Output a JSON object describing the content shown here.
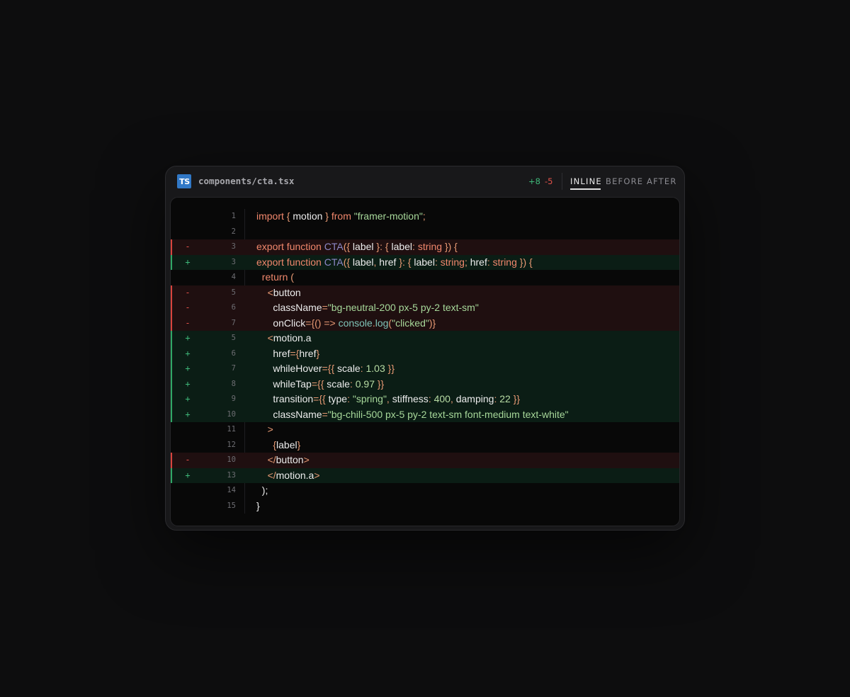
{
  "file": {
    "icon": "typescript-icon",
    "badge": "TS",
    "name": "components/cta.tsx"
  },
  "stats": {
    "added": "+8",
    "removed": "-5"
  },
  "tabs": [
    {
      "label": "INLINE",
      "active": true
    },
    {
      "label": "BEFORE",
      "active": false
    },
    {
      "label": "AFTER",
      "active": false
    }
  ],
  "colors": {
    "added": "#3fb97a",
    "removed": "#e5534b",
    "added_bg": "#0b1d15",
    "removed_bg": "#1f0f10",
    "ts_blue": "#3178c6"
  },
  "lines": [
    {
      "type": "ctx",
      "num": "1",
      "tokens": [
        [
          "kw",
          "import"
        ],
        [
          "id",
          " "
        ],
        [
          "pn",
          "{"
        ],
        [
          "id",
          " motion "
        ],
        [
          "pn",
          "}"
        ],
        [
          "id",
          " "
        ],
        [
          "kw",
          "from"
        ],
        [
          "id",
          " "
        ],
        [
          "str",
          "\"framer-motion\""
        ],
        [
          "pn",
          ";"
        ]
      ]
    },
    {
      "type": "ctx",
      "num": "2",
      "tokens": []
    },
    {
      "type": "del",
      "num": "3",
      "tokens": [
        [
          "kw",
          "export function"
        ],
        [
          "id",
          " "
        ],
        [
          "fn",
          "CTA"
        ],
        [
          "pn",
          "({"
        ],
        [
          "id",
          " label "
        ],
        [
          "pn",
          "}:"
        ],
        [
          "id",
          " "
        ],
        [
          "pn",
          "{"
        ],
        [
          "id",
          " label"
        ],
        [
          "pn",
          ":"
        ],
        [
          "id",
          " "
        ],
        [
          "kw",
          "string"
        ],
        [
          "id",
          " "
        ],
        [
          "pn",
          "})"
        ],
        [
          "id",
          " "
        ],
        [
          "pn",
          "{"
        ]
      ]
    },
    {
      "type": "add",
      "num": "3",
      "tokens": [
        [
          "kw",
          "export function"
        ],
        [
          "id",
          " "
        ],
        [
          "fn",
          "CTA"
        ],
        [
          "pn",
          "({"
        ],
        [
          "id",
          " label"
        ],
        [
          "pn",
          ","
        ],
        [
          "id",
          " href "
        ],
        [
          "pn",
          "}:"
        ],
        [
          "id",
          " "
        ],
        [
          "pn",
          "{"
        ],
        [
          "id",
          " label"
        ],
        [
          "pn",
          ":"
        ],
        [
          "id",
          " "
        ],
        [
          "kw",
          "string"
        ],
        [
          "pn",
          ";"
        ],
        [
          "id",
          " href"
        ],
        [
          "pn",
          ":"
        ],
        [
          "id",
          " "
        ],
        [
          "kw",
          "string"
        ],
        [
          "id",
          " "
        ],
        [
          "pn",
          "})"
        ],
        [
          "id",
          " "
        ],
        [
          "pn",
          "{"
        ]
      ]
    },
    {
      "type": "ctx",
      "num": "4",
      "tokens": [
        [
          "id",
          "  "
        ],
        [
          "kw",
          "return"
        ],
        [
          "id",
          " "
        ],
        [
          "pn",
          "("
        ]
      ]
    },
    {
      "type": "del",
      "num": "5",
      "tokens": [
        [
          "id",
          "    "
        ],
        [
          "pn",
          "<"
        ],
        [
          "id",
          "button"
        ]
      ]
    },
    {
      "type": "del",
      "num": "6",
      "tokens": [
        [
          "id",
          "      className"
        ],
        [
          "op",
          "="
        ],
        [
          "str",
          "\"bg-neutral-200 px-5 py-2 text-sm\""
        ]
      ]
    },
    {
      "type": "del",
      "num": "7",
      "tokens": [
        [
          "id",
          "      onClick"
        ],
        [
          "op",
          "="
        ],
        [
          "pn",
          "{()"
        ],
        [
          "id",
          " "
        ],
        [
          "op",
          "=>"
        ],
        [
          "id",
          " "
        ],
        [
          "fn2",
          "console"
        ],
        [
          "pn",
          "."
        ],
        [
          "fn2",
          "log"
        ],
        [
          "pn",
          "("
        ],
        [
          "str",
          "\"clicked\""
        ],
        [
          "pn",
          ")}"
        ]
      ]
    },
    {
      "type": "add",
      "num": "5",
      "tokens": [
        [
          "id",
          "    "
        ],
        [
          "pn",
          "<"
        ],
        [
          "id",
          "motion.a"
        ]
      ]
    },
    {
      "type": "add",
      "num": "6",
      "tokens": [
        [
          "id",
          "      href"
        ],
        [
          "op",
          "="
        ],
        [
          "pn",
          "{"
        ],
        [
          "id",
          "href"
        ],
        [
          "pn",
          "}"
        ]
      ]
    },
    {
      "type": "add",
      "num": "7",
      "tokens": [
        [
          "id",
          "      whileHover"
        ],
        [
          "op",
          "="
        ],
        [
          "pn",
          "{{"
        ],
        [
          "id",
          " scale"
        ],
        [
          "pn",
          ":"
        ],
        [
          "id",
          " "
        ],
        [
          "num",
          "1.03"
        ],
        [
          "id",
          " "
        ],
        [
          "pn",
          "}}"
        ]
      ]
    },
    {
      "type": "add",
      "num": "8",
      "tokens": [
        [
          "id",
          "      whileTap"
        ],
        [
          "op",
          "="
        ],
        [
          "pn",
          "{{"
        ],
        [
          "id",
          " scale"
        ],
        [
          "pn",
          ":"
        ],
        [
          "id",
          " "
        ],
        [
          "num",
          "0.97"
        ],
        [
          "id",
          " "
        ],
        [
          "pn",
          "}}"
        ]
      ]
    },
    {
      "type": "add",
      "num": "9",
      "tokens": [
        [
          "id",
          "      transition"
        ],
        [
          "op",
          "="
        ],
        [
          "pn",
          "{{"
        ],
        [
          "id",
          " type"
        ],
        [
          "pn",
          ":"
        ],
        [
          "id",
          " "
        ],
        [
          "str",
          "\"spring\""
        ],
        [
          "pn",
          ","
        ],
        [
          "id",
          " stiffness"
        ],
        [
          "pn",
          ":"
        ],
        [
          "id",
          " "
        ],
        [
          "num",
          "400"
        ],
        [
          "pn",
          ","
        ],
        [
          "id",
          " damping"
        ],
        [
          "pn",
          ":"
        ],
        [
          "id",
          " "
        ],
        [
          "num",
          "22"
        ],
        [
          "id",
          " "
        ],
        [
          "pn",
          "}}"
        ]
      ]
    },
    {
      "type": "add",
      "num": "10",
      "tokens": [
        [
          "id",
          "      className"
        ],
        [
          "op",
          "="
        ],
        [
          "str",
          "\"bg-chili-500 px-5 py-2 text-sm font-medium text-white\""
        ]
      ]
    },
    {
      "type": "ctx",
      "num": "11",
      "tokens": [
        [
          "id",
          "    "
        ],
        [
          "pn",
          ">"
        ]
      ]
    },
    {
      "type": "ctx",
      "num": "12",
      "tokens": [
        [
          "id",
          "      "
        ],
        [
          "pn",
          "{"
        ],
        [
          "id",
          "label"
        ],
        [
          "pn",
          "}"
        ]
      ]
    },
    {
      "type": "del",
      "num": "10",
      "tokens": [
        [
          "id",
          "    "
        ],
        [
          "pn",
          "</"
        ],
        [
          "id",
          "button"
        ],
        [
          "pn",
          ">"
        ]
      ]
    },
    {
      "type": "add",
      "num": "13",
      "tokens": [
        [
          "id",
          "    "
        ],
        [
          "pn",
          "</"
        ],
        [
          "id",
          "motion.a"
        ],
        [
          "pn",
          ">"
        ]
      ]
    },
    {
      "type": "ctx",
      "num": "14",
      "tokens": [
        [
          "id",
          "  );"
        ]
      ]
    },
    {
      "type": "ctx",
      "num": "15",
      "tokens": [
        [
          "id",
          "}"
        ]
      ]
    }
  ]
}
